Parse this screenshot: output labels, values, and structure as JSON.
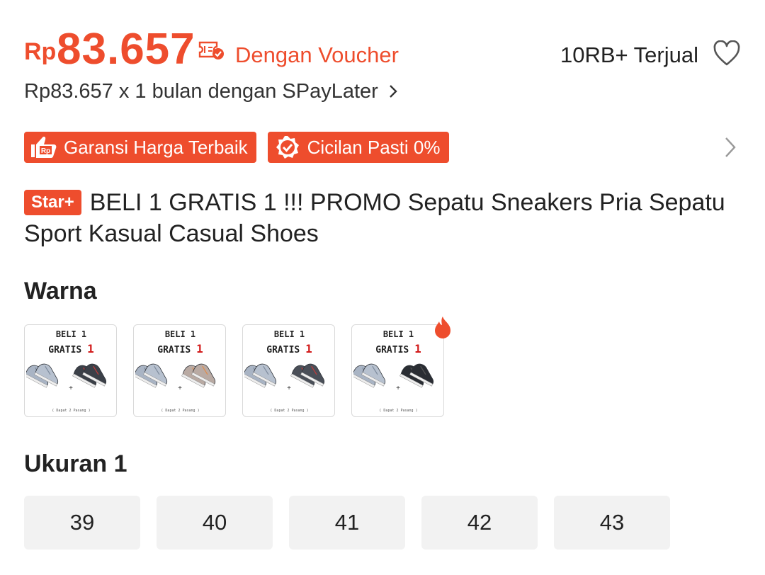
{
  "price": {
    "currency": "Rp",
    "value": "83.657",
    "voucher_label": "Dengan Voucher"
  },
  "sold": "10RB+ Terjual",
  "paylater": {
    "text": "Rp83.657 x 1 bulan dengan SPayLater"
  },
  "badges": [
    {
      "label": "Garansi Harga Terbaik",
      "icon": "price-guarantee-icon"
    },
    {
      "label": "Cicilan Pasti 0%",
      "icon": "check-badge-icon"
    }
  ],
  "product": {
    "badge": "Star+",
    "title": "BELI 1 GRATIS 1 !!! PROMO Sepatu Sneakers Pria Sepatu Sport Kasual Casual Shoes"
  },
  "warna": {
    "label": "Warna",
    "variants": [
      {
        "line1": "BELI 1",
        "line2a": "GRATIS ",
        "line2b": "1",
        "footer": "( Dapat 2 Pasang )",
        "second_shoe_color": "#3b4048",
        "accent": "#c43a3a"
      },
      {
        "line1": "BELI 1",
        "line2a": "GRATIS ",
        "line2b": "1",
        "footer": "( Dapat 2 Pasang )",
        "second_shoe_color": "#b9aaa3",
        "accent": "#e08a4a"
      },
      {
        "line1": "BELI 1",
        "line2a": "GRATIS ",
        "line2b": "1",
        "footer": "( Dapat 2 Pasang )",
        "second_shoe_color": "#4a4f58",
        "accent": "#c43a3a"
      },
      {
        "line1": "BELI 1",
        "line2a": "GRATIS ",
        "line2b": "1",
        "footer": "( Dapat 2 Pasang )",
        "second_shoe_color": "#2a2d33",
        "accent": "#555"
      }
    ]
  },
  "ukuran": {
    "label": "Ukuran 1",
    "sizes": [
      "39",
      "40",
      "41",
      "42",
      "43"
    ]
  },
  "colors": {
    "accent": "#ee4d2d",
    "chip_bg": "#f2f2f2"
  }
}
